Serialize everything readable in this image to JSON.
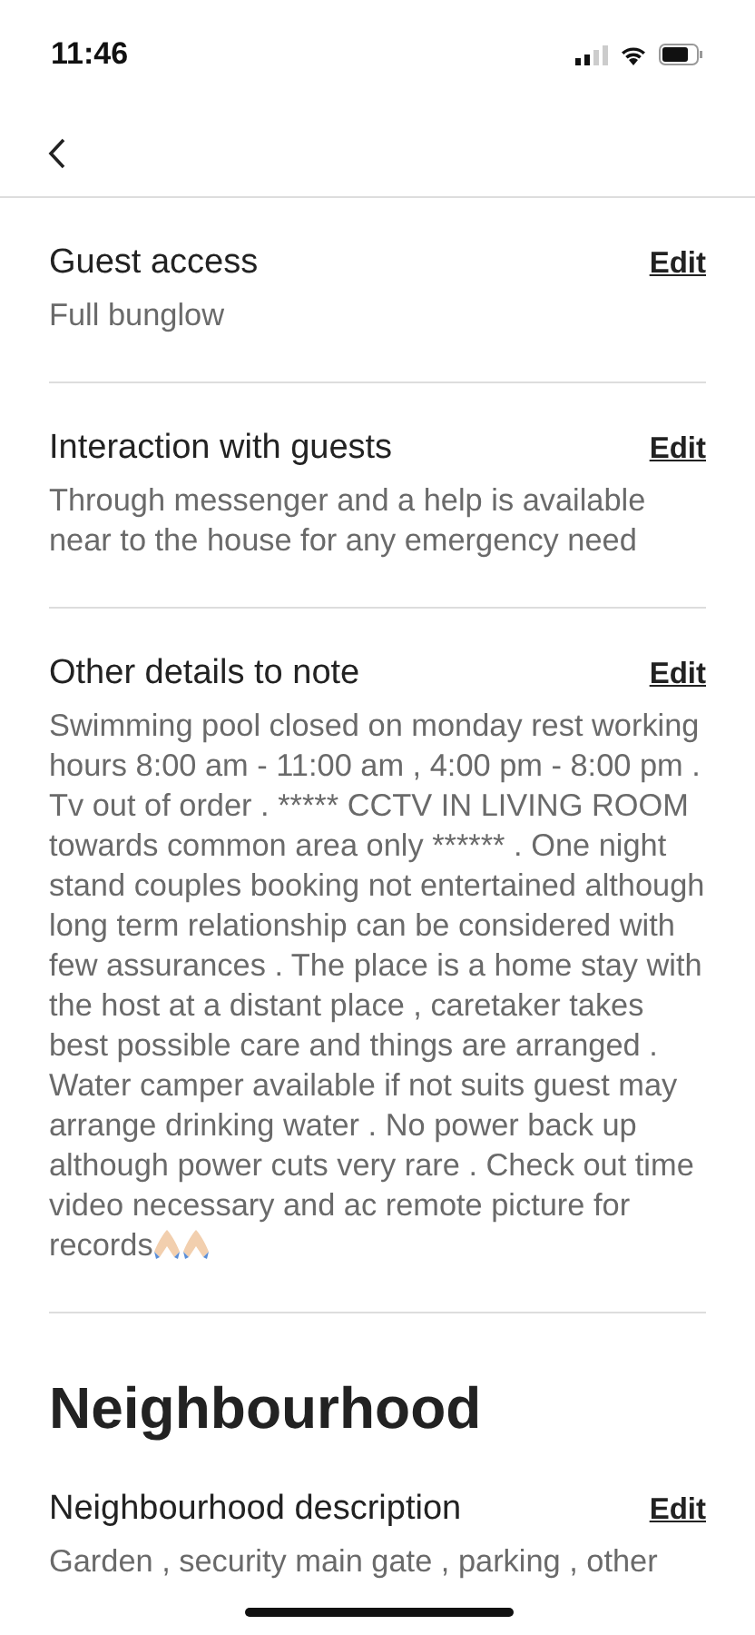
{
  "status_bar": {
    "time": "11:46"
  },
  "sections": [
    {
      "title": "Guest access",
      "action": "Edit",
      "body": "Full bunglow"
    },
    {
      "title": "Interaction with guests",
      "action": "Edit",
      "body": "Through messenger and a help is available near to the house for any emergency need"
    },
    {
      "title": "Other details to note",
      "action": "Edit",
      "body": "Swimming pool closed on monday rest working hours 8:00 am - 11:00 am , 4:00 pm - 8:00 pm . Tv out of order . ***** CCTV IN LIVING ROOM towards common area only ****** . One night stand couples booking not entertained although long term relationship can be considered with few assurances . The place is a home stay with the host at a distant place , caretaker takes best possible care and things are arranged . Water camper available if not suits guest may arrange drinking water . No power back up although power cuts very rare . Check out time video necessary and ac remote picture for records",
      "trailing_icons": [
        {
          "kind": "praying-hands"
        },
        {
          "kind": "praying-hands"
        }
      ]
    }
  ],
  "neighbourhood": {
    "heading": "Neighbourhood",
    "title": "Neighbourhood description",
    "action": "Edit",
    "body": "Garden , security main gate , parking , other"
  }
}
